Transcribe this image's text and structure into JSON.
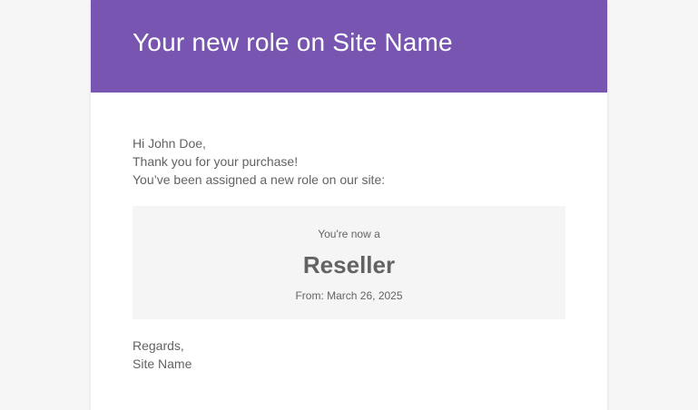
{
  "email": {
    "title": "Your new role on Site Name",
    "greeting": "Hi John Doe,",
    "thanks": "Thank you for your purchase!",
    "assigned_text": "You’ve been assigned a new role on our site:",
    "role_box": {
      "intro": "You're now a",
      "role": "Reseller",
      "from_date": "From: March 26, 2025"
    },
    "regards": "Regards,",
    "signature": "Site Name"
  },
  "colors": {
    "header_bg": "#7755b0",
    "page_bg": "#f6f6f6",
    "box_bg": "#f5f5f5",
    "text": "#636363"
  }
}
